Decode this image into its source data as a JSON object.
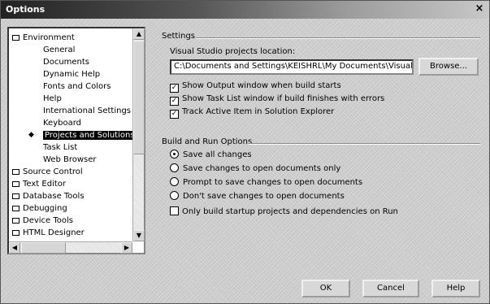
{
  "window": {
    "title": "Options",
    "close_glyph": "×"
  },
  "tree": {
    "items": [
      {
        "label": "Environment",
        "level": 0
      },
      {
        "label": "General",
        "level": 1
      },
      {
        "label": "Documents",
        "level": 1
      },
      {
        "label": "Dynamic Help",
        "level": 1
      },
      {
        "label": "Fonts and Colors",
        "level": 1
      },
      {
        "label": "Help",
        "level": 1
      },
      {
        "label": "International Settings",
        "level": 1
      },
      {
        "label": "Keyboard",
        "level": 1
      },
      {
        "label": "Projects and Solutions",
        "level": 1,
        "selected": true
      },
      {
        "label": "Task List",
        "level": 1
      },
      {
        "label": "Web Browser",
        "level": 1
      },
      {
        "label": "Source Control",
        "level": 0
      },
      {
        "label": "Text Editor",
        "level": 0
      },
      {
        "label": "Database Tools",
        "level": 0
      },
      {
        "label": "Debugging",
        "level": 0
      },
      {
        "label": "Device Tools",
        "level": 0
      },
      {
        "label": "HTML Designer",
        "level": 0
      }
    ]
  },
  "settings": {
    "heading": "Settings",
    "location_label": "Visual Studio projects location:",
    "location_value": "C:\\Documents and Settings\\KEISHRL\\My Documents\\Visual S",
    "browse_label": "Browse...",
    "checkboxes": [
      {
        "label": "Show Output window when build starts",
        "checked": true
      },
      {
        "label": "Show Task List window if build finishes with errors",
        "checked": true
      },
      {
        "label": "Track Active Item in Solution Explorer",
        "checked": true
      }
    ]
  },
  "build": {
    "heading": "Build and Run Options",
    "radios": [
      {
        "label": "Save all changes",
        "selected": true
      },
      {
        "label": "Save changes to open documents only",
        "selected": false
      },
      {
        "label": "Prompt to save changes to open documents",
        "selected": false
      },
      {
        "label": "Don't save changes to open documents",
        "selected": false
      }
    ],
    "startup_checkbox": {
      "label": "Only build startup projects and dependencies on Run",
      "checked": false
    }
  },
  "buttons": {
    "ok": "OK",
    "cancel": "Cancel",
    "help": "Help"
  }
}
